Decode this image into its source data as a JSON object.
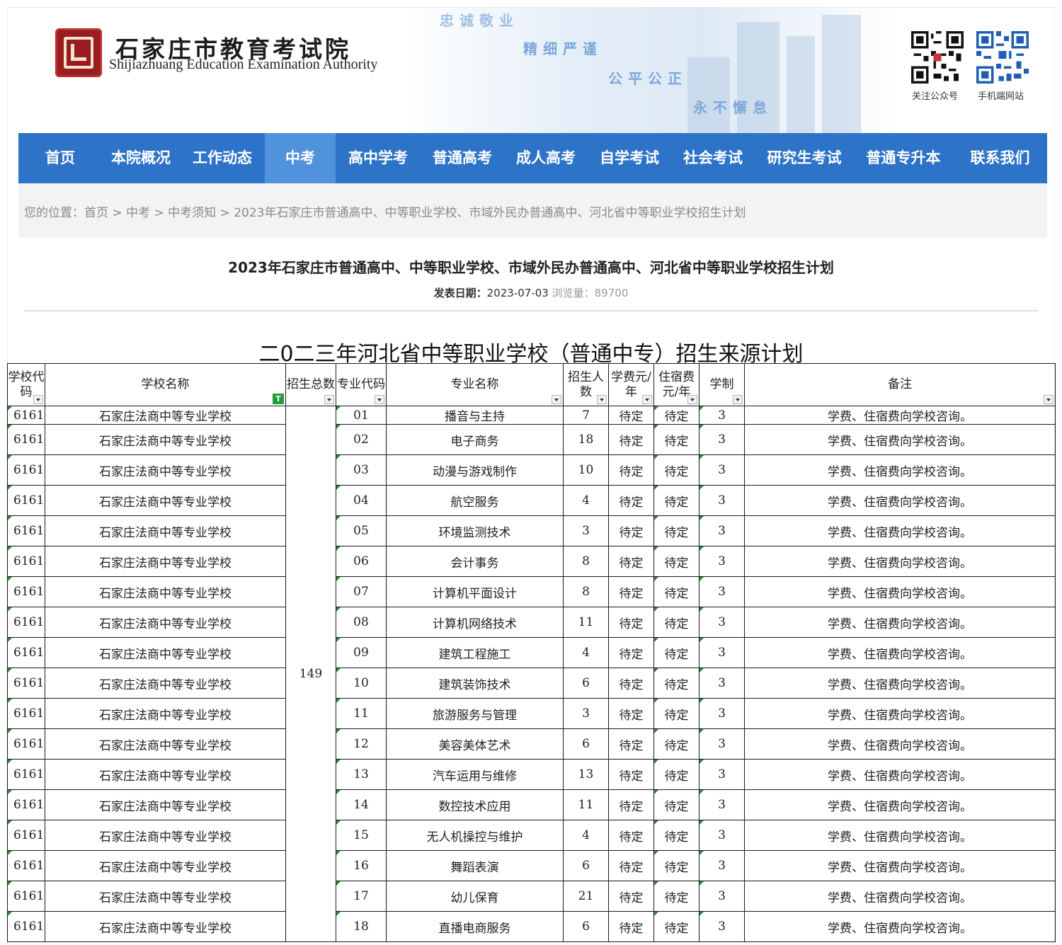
{
  "brand": {
    "title": "石家庄市教育考试院",
    "subtitle": "Shijiazhuang Education Examination Authority",
    "slogans": [
      "忠诚敬业",
      "精细严谨",
      "公平公正",
      "永不懈怠"
    ],
    "qr_wechat_caption": "关注公众号",
    "qr_mobile_caption": "手机端网站"
  },
  "nav": {
    "items": [
      "首页",
      "本院概况",
      "工作动态",
      "中考",
      "高中学考",
      "普通高考",
      "成人高考",
      "自学考试",
      "社会考试",
      "研究生考试",
      "普通专升本",
      "联系我们"
    ],
    "active": "中考"
  },
  "breadcrumb": {
    "prefix": "您的位置：",
    "sep": " > ",
    "items": [
      "首页",
      "中考",
      "中考须知",
      "2023年石家庄市普通高中、中等职业学校、市域外民办普通高中、河北省中等职业学校招生计划"
    ]
  },
  "article": {
    "title": "2023年石家庄市普通高中、中等职业学校、市域外民办普通高中、河北省中等职业学校招生计划",
    "date_label": "发表日期：",
    "date": "2023-07-03",
    "views_label": "浏览量：",
    "views": "89700"
  },
  "sheet": {
    "title": "二0二三年河北省中等职业学校（普通中专）招生来源计划",
    "headers": [
      "学校代码",
      "学校名称",
      "招生总数",
      "专业代码",
      "专业名称",
      "招生人数",
      "学费元/年",
      "住宿费元/年",
      "学制",
      "备注"
    ],
    "total": "149",
    "rows": [
      {
        "school_code": "6161",
        "school": "石家庄法商中等专业学校",
        "major_code": "01",
        "major": "播音与主持",
        "count": "7",
        "tuition": "待定",
        "lodging": "待定",
        "years": "3",
        "note": "学费、住宿费向学校咨询。"
      },
      {
        "school_code": "6161",
        "school": "石家庄法商中等专业学校",
        "major_code": "02",
        "major": "电子商务",
        "count": "18",
        "tuition": "待定",
        "lodging": "待定",
        "years": "3",
        "note": "学费、住宿费向学校咨询。"
      },
      {
        "school_code": "6161",
        "school": "石家庄法商中等专业学校",
        "major_code": "03",
        "major": "动漫与游戏制作",
        "count": "10",
        "tuition": "待定",
        "lodging": "待定",
        "years": "3",
        "note": "学费、住宿费向学校咨询。"
      },
      {
        "school_code": "6161",
        "school": "石家庄法商中等专业学校",
        "major_code": "04",
        "major": "航空服务",
        "count": "4",
        "tuition": "待定",
        "lodging": "待定",
        "years": "3",
        "note": "学费、住宿费向学校咨询。"
      },
      {
        "school_code": "6161",
        "school": "石家庄法商中等专业学校",
        "major_code": "05",
        "major": "环境监测技术",
        "count": "3",
        "tuition": "待定",
        "lodging": "待定",
        "years": "3",
        "note": "学费、住宿费向学校咨询。"
      },
      {
        "school_code": "6161",
        "school": "石家庄法商中等专业学校",
        "major_code": "06",
        "major": "会计事务",
        "count": "8",
        "tuition": "待定",
        "lodging": "待定",
        "years": "3",
        "note": "学费、住宿费向学校咨询。"
      },
      {
        "school_code": "6161",
        "school": "石家庄法商中等专业学校",
        "major_code": "07",
        "major": "计算机平面设计",
        "count": "8",
        "tuition": "待定",
        "lodging": "待定",
        "years": "3",
        "note": "学费、住宿费向学校咨询。"
      },
      {
        "school_code": "6161",
        "school": "石家庄法商中等专业学校",
        "major_code": "08",
        "major": "计算机网络技术",
        "count": "11",
        "tuition": "待定",
        "lodging": "待定",
        "years": "3",
        "note": "学费、住宿费向学校咨询。"
      },
      {
        "school_code": "6161",
        "school": "石家庄法商中等专业学校",
        "major_code": "09",
        "major": "建筑工程施工",
        "count": "4",
        "tuition": "待定",
        "lodging": "待定",
        "years": "3",
        "note": "学费、住宿费向学校咨询。"
      },
      {
        "school_code": "6161",
        "school": "石家庄法商中等专业学校",
        "major_code": "10",
        "major": "建筑装饰技术",
        "count": "6",
        "tuition": "待定",
        "lodging": "待定",
        "years": "3",
        "note": "学费、住宿费向学校咨询。"
      },
      {
        "school_code": "6161",
        "school": "石家庄法商中等专业学校",
        "major_code": "11",
        "major": "旅游服务与管理",
        "count": "3",
        "tuition": "待定",
        "lodging": "待定",
        "years": "3",
        "note": "学费、住宿费向学校咨询。"
      },
      {
        "school_code": "6161",
        "school": "石家庄法商中等专业学校",
        "major_code": "12",
        "major": "美容美体艺术",
        "count": "6",
        "tuition": "待定",
        "lodging": "待定",
        "years": "3",
        "note": "学费、住宿费向学校咨询。"
      },
      {
        "school_code": "6161",
        "school": "石家庄法商中等专业学校",
        "major_code": "13",
        "major": "汽车运用与维修",
        "count": "13",
        "tuition": "待定",
        "lodging": "待定",
        "years": "3",
        "note": "学费、住宿费向学校咨询。"
      },
      {
        "school_code": "6161",
        "school": "石家庄法商中等专业学校",
        "major_code": "14",
        "major": "数控技术应用",
        "count": "11",
        "tuition": "待定",
        "lodging": "待定",
        "years": "3",
        "note": "学费、住宿费向学校咨询。"
      },
      {
        "school_code": "6161",
        "school": "石家庄法商中等专业学校",
        "major_code": "15",
        "major": "无人机操控与维护",
        "count": "4",
        "tuition": "待定",
        "lodging": "待定",
        "years": "3",
        "note": "学费、住宿费向学校咨询。"
      },
      {
        "school_code": "6161",
        "school": "石家庄法商中等专业学校",
        "major_code": "16",
        "major": "舞蹈表演",
        "count": "6",
        "tuition": "待定",
        "lodging": "待定",
        "years": "3",
        "note": "学费、住宿费向学校咨询。"
      },
      {
        "school_code": "6161",
        "school": "石家庄法商中等专业学校",
        "major_code": "17",
        "major": "幼儿保育",
        "count": "21",
        "tuition": "待定",
        "lodging": "待定",
        "years": "3",
        "note": "学费、住宿费向学校咨询。"
      },
      {
        "school_code": "6161",
        "school": "石家庄法商中等专业学校",
        "major_code": "18",
        "major": "直播电商服务",
        "count": "6",
        "tuition": "待定",
        "lodging": "待定",
        "years": "3",
        "note": "学费、住宿费向学校咨询。"
      }
    ]
  },
  "colors": {
    "nav_bg": "#2d73c7",
    "nav_active": "#5092dc",
    "seal_red": "#9b1c1c",
    "slogan_blue": "#7da7d9",
    "breadcrumb_bg": "#f2f3f5",
    "filter_green": "#1f9d3b"
  }
}
